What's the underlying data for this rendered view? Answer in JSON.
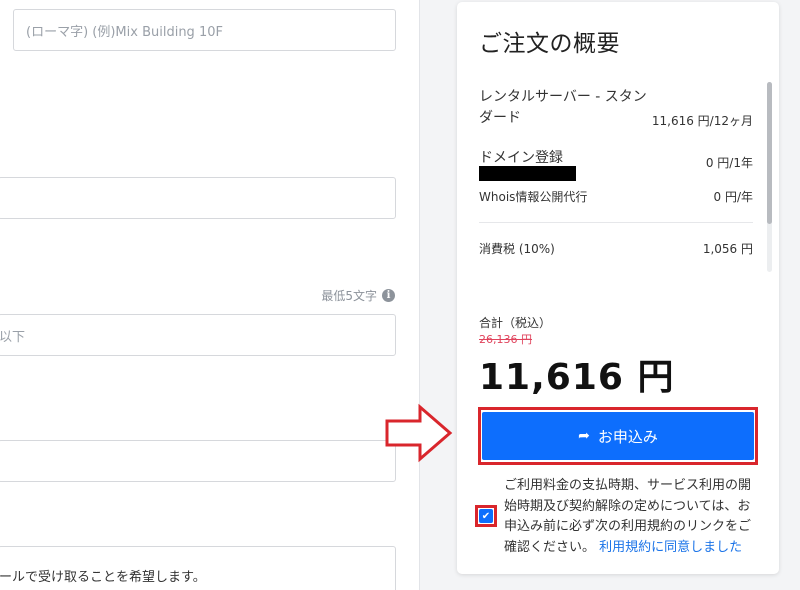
{
  "form": {
    "building_placeholder": "(ローマ字) (例)Mix Building 10F",
    "min_chars_hint": "最低5文字",
    "field3_fragment": "以下",
    "email_pref_fragment": "ールで受け取ることを希望します。"
  },
  "summary": {
    "title": "ご注文の概要",
    "items": [
      {
        "name": "レンタルサーバー - スタンダード",
        "price": "11,616 円/12ヶ月"
      },
      {
        "name": "ドメイン登録",
        "price": "0 円/1年"
      },
      {
        "name": "Whois情報公開代行",
        "price": "0 円/年"
      },
      {
        "name": "消費税 (10%)",
        "price": "1,056 円"
      }
    ],
    "total_label": "合計（税込）",
    "original_price": "26,136 円",
    "total_price": "11,616 円",
    "apply_button": "お申込み",
    "terms_text": "ご利用料金の支払時期、サービス利用の開始時期及び契約解除の定めについては、お申込み前に必ず次の利用規約のリンクをご確認ください。",
    "terms_link": "利用規約に同意しました"
  },
  "icons": {
    "info": "info-icon",
    "apply": "arrow-right-icon",
    "check": "check-icon"
  },
  "colors": {
    "primary": "#0d6efd",
    "annotation_red": "#d9262c",
    "strike_price": "#e0435c",
    "link": "#1a73e8"
  }
}
